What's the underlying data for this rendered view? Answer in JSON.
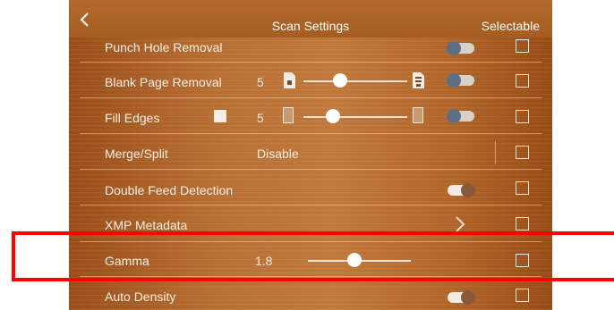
{
  "header": {
    "title": "Scan Settings",
    "right_label": "Selectable"
  },
  "rows": [
    {
      "label": "Punch Hole Removal",
      "toggle": "off",
      "selectable": false
    },
    {
      "label": "Blank Page Removal",
      "value": "5",
      "slider_level": 0.33,
      "toggle": "off",
      "selectable": false
    },
    {
      "label": "Fill Edges",
      "value": "5",
      "slider_level": 0.25,
      "toggle": "off",
      "selectable": false
    },
    {
      "label": "Merge/Split",
      "value": "Disable",
      "selectable": false
    },
    {
      "label": "Double Feed Detection",
      "toggle": "on",
      "selectable": false
    },
    {
      "label": "XMP Metadata",
      "selectable": false
    },
    {
      "label": "Gamma",
      "value": "1.8",
      "slider_level": 0.45,
      "selectable": false
    },
    {
      "label": "Auto Density",
      "toggle": "on",
      "selectable": false
    }
  ],
  "highlight": {
    "color": "#ff0000"
  },
  "colors": {
    "wood": "#b86f31",
    "text": "#f6efe6"
  }
}
